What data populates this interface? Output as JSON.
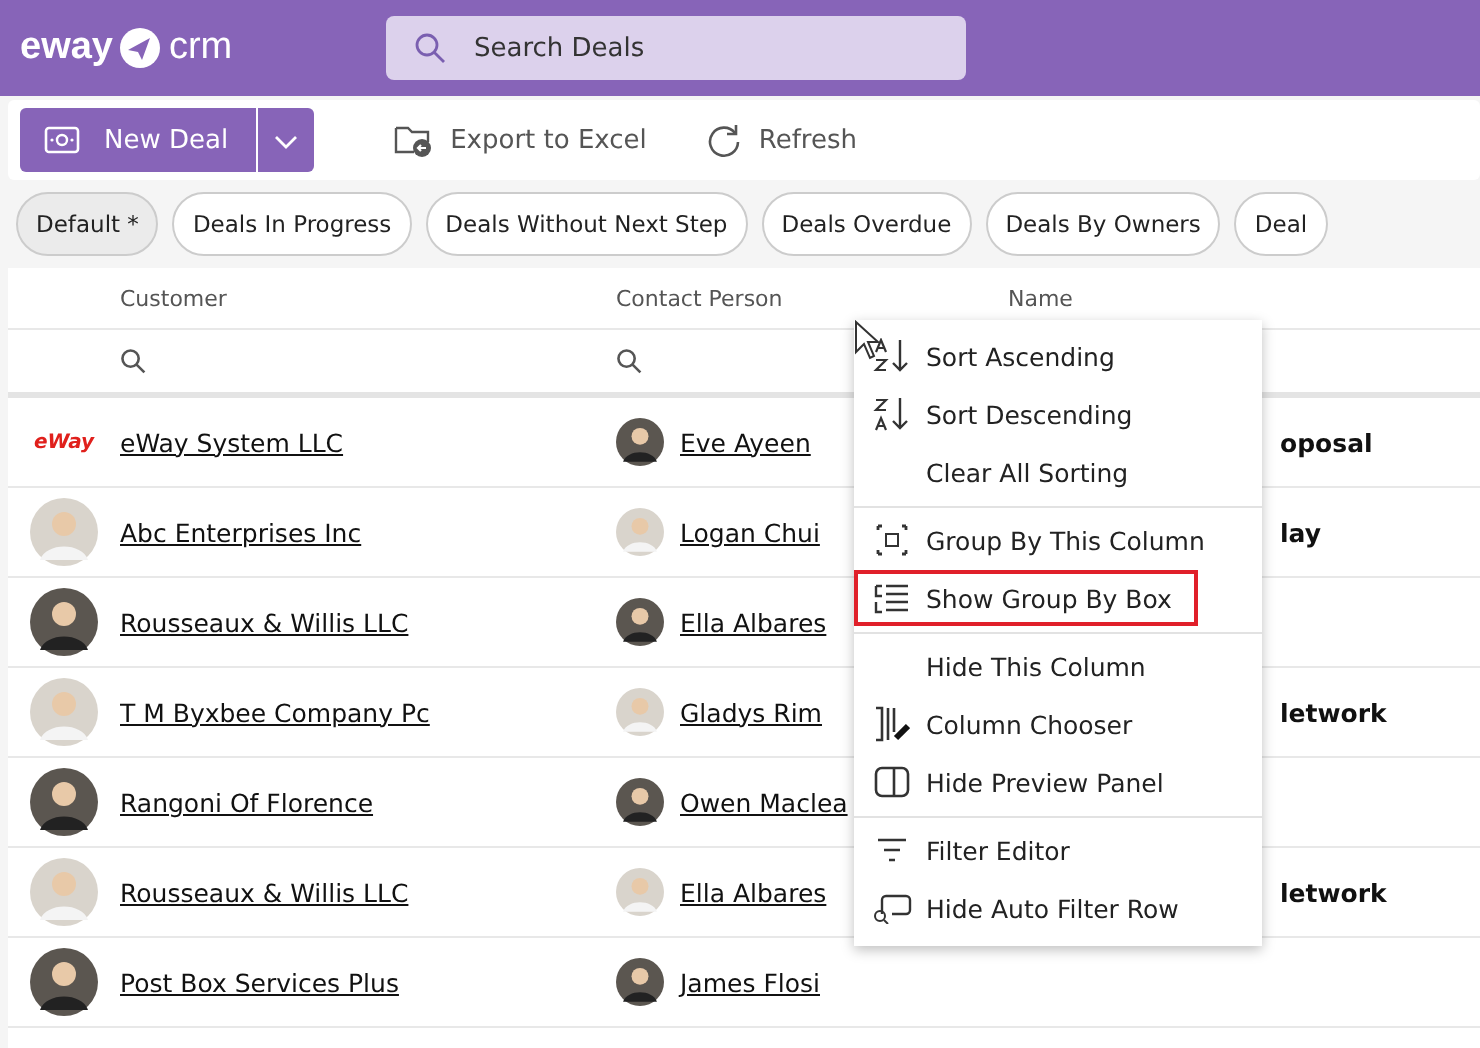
{
  "header": {
    "logo_left": "eway",
    "logo_right": "crm",
    "search": {
      "placeholder": "Search Deals"
    }
  },
  "toolbar": {
    "new_button": "New Deal",
    "actions": [
      {
        "kind": "export",
        "label": "Export to Excel"
      },
      {
        "kind": "refresh",
        "label": "Refresh"
      }
    ]
  },
  "views": [
    {
      "label": "Default *",
      "selected": true
    },
    {
      "label": "Deals In Progress",
      "selected": false
    },
    {
      "label": "Deals Without Next Step",
      "selected": false
    },
    {
      "label": "Deals Overdue",
      "selected": false
    },
    {
      "label": "Deals By Owners",
      "selected": false
    },
    {
      "label": "Deal",
      "selected": false
    }
  ],
  "table": {
    "columns": [
      "Customer",
      "Contact Person",
      "Name"
    ],
    "rows": [
      {
        "kind": "logo",
        "logo_text": "eWay",
        "customer": "eWay System LLC",
        "contact": "Eve Ayeen",
        "name": "oposal"
      },
      {
        "customer": "Abc Enterprises Inc",
        "contact": "Logan Chui",
        "name": "lay"
      },
      {
        "customer": "Rousseaux & Willis LLC",
        "contact": "Ella Albares"
      },
      {
        "customer": "T M Byxbee Company Pc",
        "contact": "Gladys Rim",
        "name": "letwork"
      },
      {
        "customer": "Rangoni Of Florence",
        "contact": "Owen Maclea"
      },
      {
        "customer": "Rousseaux & Willis LLC",
        "contact": "Ella Albares",
        "name": "letwork"
      },
      {
        "customer": "Post Box Services Plus",
        "contact": "James Flosi"
      }
    ]
  },
  "context_menu": {
    "groups": [
      [
        {
          "kind": "sort-asc",
          "label": "Sort Ascending",
          "highlighted": false
        },
        {
          "kind": "sort-desc",
          "label": "Sort Descending",
          "highlighted": false
        },
        {
          "kind": "none",
          "label": "Clear All Sorting",
          "highlighted": false
        }
      ],
      [
        {
          "kind": "group",
          "label": "Group By This Column",
          "highlighted": false
        },
        {
          "kind": "list",
          "label": "Show Group By Box",
          "highlighted": true
        }
      ],
      [
        {
          "kind": "none",
          "label": "Hide This Column",
          "highlighted": false
        },
        {
          "kind": "columns",
          "label": "Column Chooser",
          "highlighted": false
        },
        {
          "kind": "panel",
          "label": "Hide Preview Panel",
          "highlighted": false
        }
      ],
      [
        {
          "kind": "filter",
          "label": "Filter Editor",
          "highlighted": false
        },
        {
          "kind": "filter-row",
          "label": "Hide Auto Filter Row",
          "highlighted": false
        }
      ]
    ]
  }
}
